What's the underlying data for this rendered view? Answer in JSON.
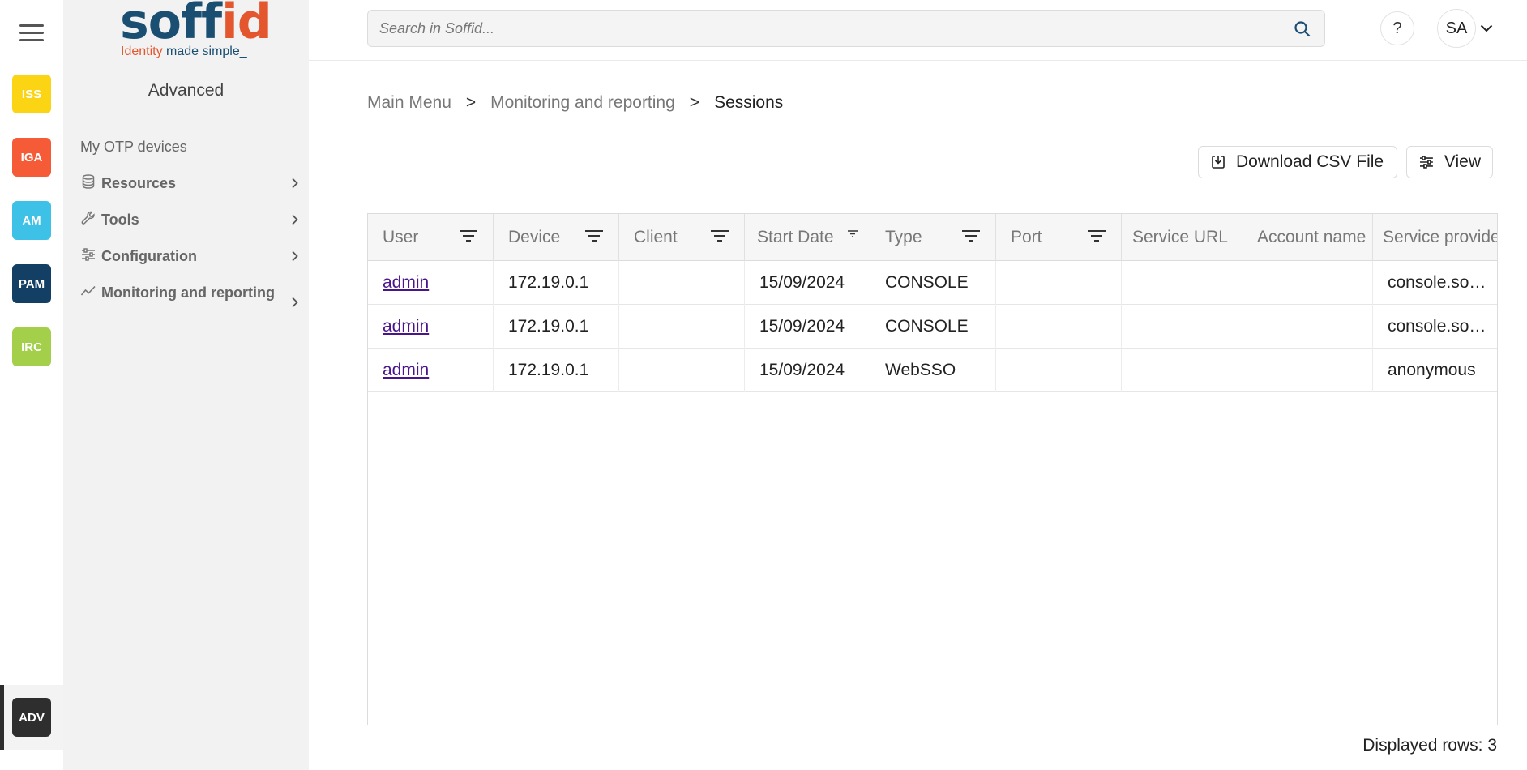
{
  "rail": {
    "apps": [
      {
        "label": "ISS",
        "color": "#fbd414"
      },
      {
        "label": "IGA",
        "color": "#f55b36"
      },
      {
        "label": "AM",
        "color": "#3ec1e6"
      },
      {
        "label": "PAM",
        "color": "#123f63"
      },
      {
        "label": "IRC",
        "color": "#a3cf4a"
      }
    ],
    "active_app": {
      "label": "ADV",
      "color": "#2e2e2e"
    }
  },
  "sidebar": {
    "logo": {
      "word_main": "soff",
      "word_accent": "id",
      "tag_accent": "Identity",
      "tag_rest": " made simple_"
    },
    "title": "Advanced",
    "items": [
      {
        "label": "My OTP devices",
        "icon": "none"
      },
      {
        "label": "Resources",
        "icon": "database-icon"
      },
      {
        "label": "Tools",
        "icon": "wrench-icon"
      },
      {
        "label": "Configuration",
        "icon": "sliders-icon"
      },
      {
        "label": "Monitoring and reporting",
        "icon": "chart-line-icon"
      }
    ]
  },
  "topbar": {
    "search_placeholder": "Search in Soffid...",
    "help_label": "?",
    "avatar_initials": "SA"
  },
  "breadcrumb": [
    "Main Menu",
    "Monitoring and reporting",
    "Sessions"
  ],
  "breadcrumb_sep": ">",
  "actions": {
    "download_label": "Download CSV File",
    "view_label": "View"
  },
  "grid": {
    "columns": [
      "User",
      "Device",
      "Client",
      "Start Date",
      "Type",
      "Port",
      "Service URL",
      "Account name",
      "Service provider"
    ],
    "rows": [
      [
        "admin",
        "172.19.0.1",
        "",
        "15/09/2024",
        "CONSOLE",
        "",
        "",
        "",
        "console.soffid"
      ],
      [
        "admin",
        "172.19.0.1",
        "",
        "15/09/2024",
        "CONSOLE",
        "",
        "",
        "",
        "console.soffid"
      ],
      [
        "admin",
        "172.19.0.1",
        "",
        "15/09/2024",
        "WebSSO",
        "",
        "",
        "",
        "anonymous"
      ]
    ]
  },
  "footer": {
    "row_count_label": "Displayed rows: 3"
  }
}
